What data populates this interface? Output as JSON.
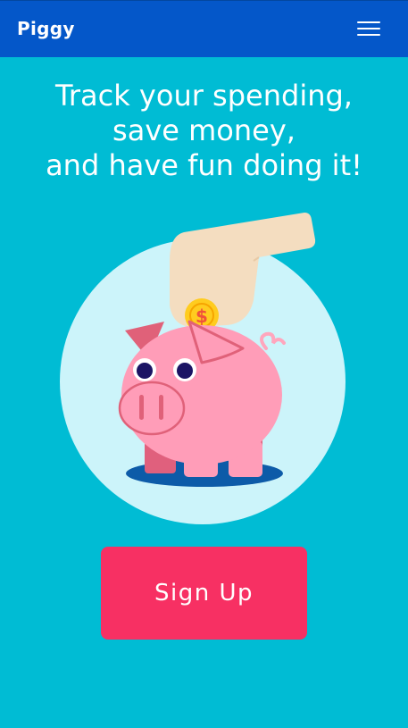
{
  "navbar": {
    "brand": "Piggy",
    "menu_icon": "hamburger-menu-icon",
    "color": "#0457c9"
  },
  "hero": {
    "headline_lines": [
      "Track your spending,",
      "save money,",
      "and have fun doing it!"
    ],
    "illustration": "piggy-bank-coin-hand-illustration",
    "background_color": "#00bcd4"
  },
  "cta": {
    "signup_label": "Sign Up",
    "color": "#f73063"
  }
}
